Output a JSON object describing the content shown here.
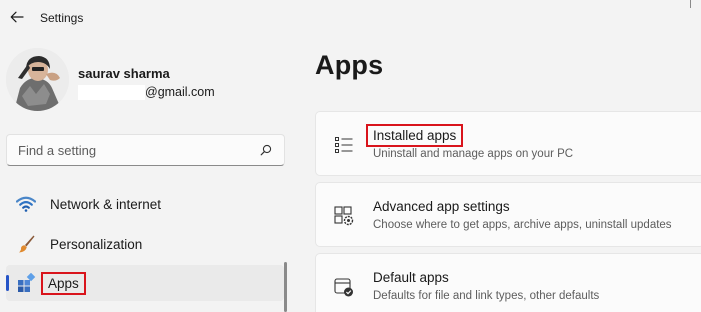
{
  "window": {
    "title": "Settings"
  },
  "profile": {
    "name": "saurav sharma",
    "email_suffix": "@gmail.com"
  },
  "search": {
    "placeholder": "Find a setting"
  },
  "sidebar": {
    "items": [
      {
        "label": "Network & internet",
        "icon": "wifi-icon",
        "active": false
      },
      {
        "label": "Personalization",
        "icon": "paintbrush-icon",
        "active": false
      },
      {
        "label": "Apps",
        "icon": "apps-icon",
        "active": true,
        "highlighted": true
      }
    ]
  },
  "main": {
    "title": "Apps",
    "cards": [
      {
        "title": "Installed apps",
        "description": "Uninstall and manage apps on your PC",
        "icon": "list-icon",
        "highlighted": true
      },
      {
        "title": "Advanced app settings",
        "description": "Choose where to get apps, archive apps, uninstall updates",
        "icon": "app-settings-icon"
      },
      {
        "title": "Default apps",
        "description": "Defaults for file and link types, other defaults",
        "icon": "default-apps-icon"
      }
    ]
  },
  "colors": {
    "accent": "#2554c7",
    "highlight_box": "#d9141c",
    "background": "#f3f3f3",
    "card": "#fbfbfb"
  }
}
